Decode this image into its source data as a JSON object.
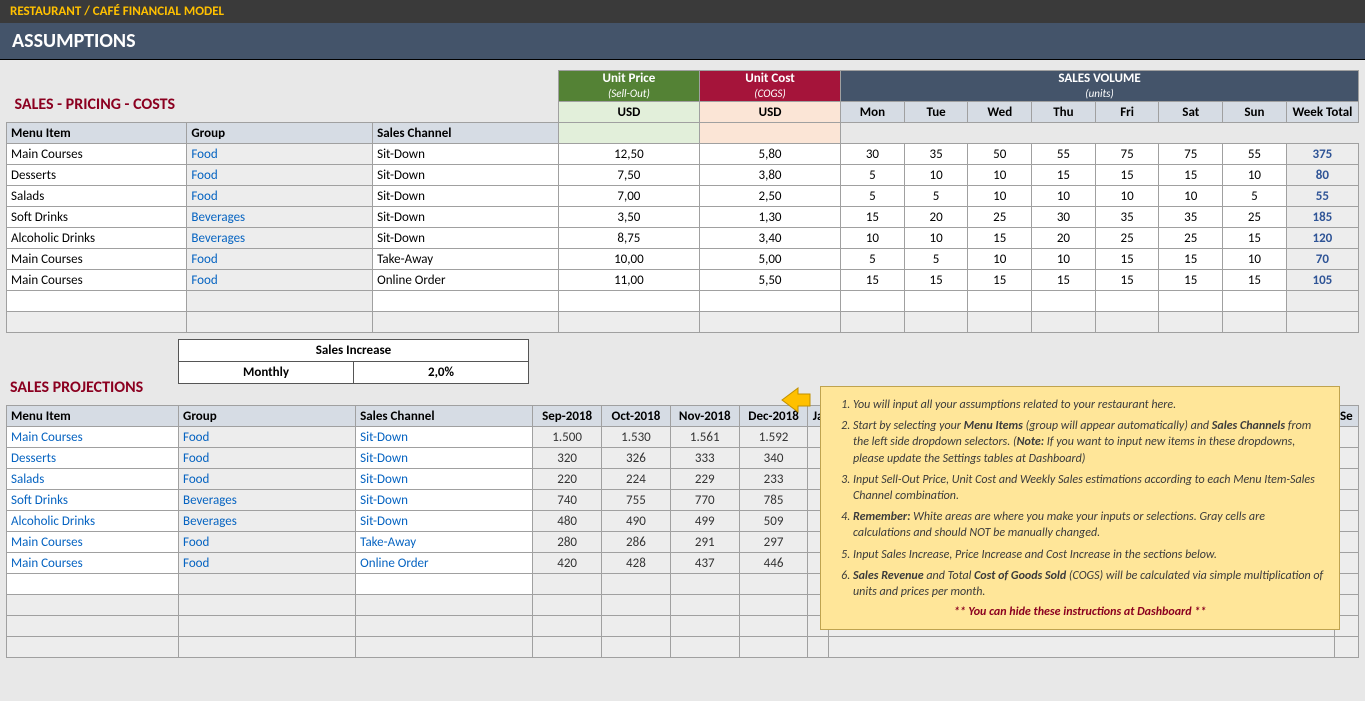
{
  "header": {
    "app_title": "RESTAURANT / CAFÉ FINANCIAL MODEL",
    "page_title": "ASSUMPTIONS"
  },
  "section1": {
    "title": "SALES - PRICING - COSTS",
    "col_menu": "Menu Item",
    "col_group": "Group",
    "col_channel": "Sales Channel",
    "price_hdr": "Unit Price",
    "price_sub": "(Sell-Out)",
    "price_ccy": "USD",
    "cost_hdr": "Unit Cost",
    "cost_sub": "(COGS)",
    "cost_ccy": "USD",
    "vol_hdr": "SALES VOLUME",
    "vol_sub": "(units)",
    "days": [
      "Mon",
      "Tue",
      "Wed",
      "Thu",
      "Fri",
      "Sat",
      "Sun"
    ],
    "wk_total": "Week Total",
    "rows": [
      {
        "menu": "Main Courses",
        "group": "Food",
        "channel": "Sit-Down",
        "price": "12,50",
        "cost": "5,80",
        "d": [
          "30",
          "35",
          "50",
          "55",
          "75",
          "75",
          "55"
        ],
        "tot": "375"
      },
      {
        "menu": "Desserts",
        "group": "Food",
        "channel": "Sit-Down",
        "price": "7,50",
        "cost": "3,80",
        "d": [
          "5",
          "10",
          "10",
          "15",
          "15",
          "15",
          "10"
        ],
        "tot": "80"
      },
      {
        "menu": "Salads",
        "group": "Food",
        "channel": "Sit-Down",
        "price": "7,00",
        "cost": "2,50",
        "d": [
          "5",
          "5",
          "10",
          "10",
          "10",
          "10",
          "5"
        ],
        "tot": "55"
      },
      {
        "menu": "Soft Drinks",
        "group": "Beverages",
        "channel": "Sit-Down",
        "price": "3,50",
        "cost": "1,30",
        "d": [
          "15",
          "20",
          "25",
          "30",
          "35",
          "35",
          "25"
        ],
        "tot": "185"
      },
      {
        "menu": "Alcoholic Drinks",
        "group": "Beverages",
        "channel": "Sit-Down",
        "price": "8,75",
        "cost": "3,40",
        "d": [
          "10",
          "10",
          "15",
          "20",
          "25",
          "25",
          "15"
        ],
        "tot": "120"
      },
      {
        "menu": "Main Courses",
        "group": "Food",
        "channel": "Take-Away",
        "price": "10,00",
        "cost": "5,00",
        "d": [
          "5",
          "5",
          "10",
          "10",
          "15",
          "15",
          "10"
        ],
        "tot": "70"
      },
      {
        "menu": "Main Courses",
        "group": "Food",
        "channel": "Online Order",
        "price": "11,00",
        "cost": "5,50",
        "d": [
          "15",
          "15",
          "15",
          "15",
          "15",
          "15",
          "15"
        ],
        "tot": "105"
      }
    ]
  },
  "sales_increase": {
    "title": "Sales Increase",
    "label": "Monthly",
    "value": "2,0%"
  },
  "section2": {
    "title": "SALES PROJECTIONS",
    "col_menu": "Menu Item",
    "col_group": "Group",
    "col_channel": "Sales Channel",
    "months": [
      "Sep-2018",
      "Oct-2018",
      "Nov-2018",
      "Dec-2018"
    ],
    "month_partial": "Ja",
    "month_right": "Se",
    "rows": [
      {
        "menu": "Main Courses",
        "group": "Food",
        "channel": "Sit-Down",
        "v": [
          "1.500",
          "1.530",
          "1.561",
          "1.592"
        ]
      },
      {
        "menu": "Desserts",
        "group": "Food",
        "channel": "Sit-Down",
        "v": [
          "320",
          "326",
          "333",
          "340"
        ]
      },
      {
        "menu": "Salads",
        "group": "Food",
        "channel": "Sit-Down",
        "v": [
          "220",
          "224",
          "229",
          "233"
        ]
      },
      {
        "menu": "Soft Drinks",
        "group": "Beverages",
        "channel": "Sit-Down",
        "v": [
          "740",
          "755",
          "770",
          "785"
        ]
      },
      {
        "menu": "Alcoholic Drinks",
        "group": "Beverages",
        "channel": "Sit-Down",
        "v": [
          "480",
          "490",
          "499",
          "509"
        ]
      },
      {
        "menu": "Main Courses",
        "group": "Food",
        "channel": "Take-Away",
        "v": [
          "280",
          "286",
          "291",
          "297"
        ]
      },
      {
        "menu": "Main Courses",
        "group": "Food",
        "channel": "Online Order",
        "v": [
          "420",
          "428",
          "437",
          "446"
        ]
      }
    ]
  },
  "note": {
    "i1": "You will input all your assumptions related to your restaurant here.",
    "i2a": "Start by selecting your ",
    "i2b": "Menu Items",
    "i2c": " (group will appear automatically) and ",
    "i2d": "Sales Channels",
    "i2e": " from the left side dropdown selectors. (",
    "i2f": "Note:",
    "i2g": " If you want to input new items in these dropdowns, please update the Settings tables at Dashboard)",
    "i3": "Input Sell-Out Price, Unit Cost and Weekly Sales estimations according to each Menu Item-Sales Channel combination.",
    "i4a": "Remember:",
    "i4b": " White areas are where you make your inputs or selections. Gray cells are calculations and should NOT be manually changed.",
    "i5": "Input Sales Increase, Price Increase and Cost Increase in the sections below.",
    "i6a": "Sales Revenue",
    "i6b": " and Total ",
    "i6c": "Cost of Goods Sold",
    "i6d": " (COGS) will be calculated via simple multiplication of units and prices per month.",
    "footer": "** You can hide these instructions at Dashboard **"
  }
}
